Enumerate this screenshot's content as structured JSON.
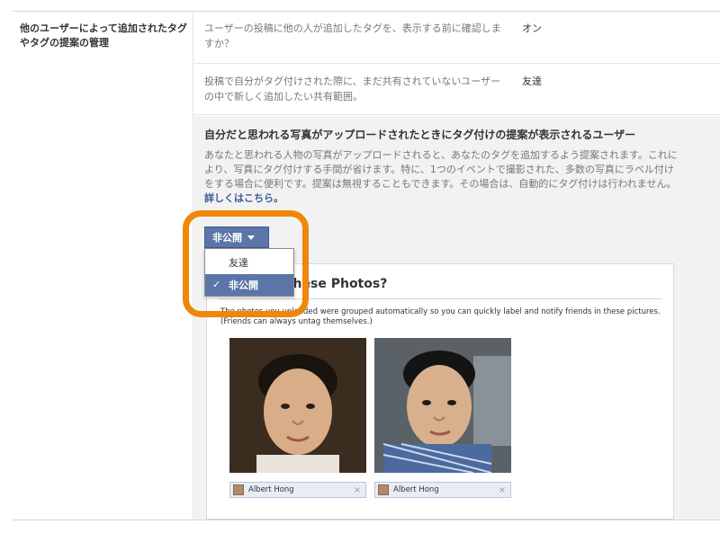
{
  "setting": {
    "label": "他のユーザーによって追加されたタグやタグの提案の管理"
  },
  "rows": [
    {
      "description": "ユーザーの投稿に他の人が追加したタグを、表示する前に確認しますか？",
      "value": "オン"
    },
    {
      "description": "投稿で自分がタグ付けされた際に、まだ共有されていないユーザーの中で新しく追加したい共有範囲。",
      "value": "友達"
    }
  ],
  "panel": {
    "title": "自分だと思われる写真がアップロードされたときにタグ付けの提案が表示されるユーザー",
    "description": "あなたと思われる人物の写真がアップロードされると、あなたのタグを追加するよう提案されます。これにより、写真にタグ付けする手間が省けます。特に、1つのイベントで撮影された、多数の写真にラベル付けをする場合に便利です。提案は無視することもできます。その場合は、自動的にタグ付けは行われません。",
    "link": "詳しくはこちら。"
  },
  "privacy_button": {
    "label": "非公開"
  },
  "menu": {
    "items": [
      {
        "label": "友達",
        "selected": false
      },
      {
        "label": "非公開",
        "selected": true
      }
    ],
    "check": "✓"
  },
  "photo_card": {
    "title": "These Photos?",
    "description": "The photos you uploaded were grouped automatically so you can quickly label and notify friends in these pictures. (Friends can always untag themselves.)",
    "tags": [
      {
        "name": "Albert Hong"
      },
      {
        "name": "Albert Hong"
      }
    ],
    "close_glyph": "×"
  },
  "colors": {
    "highlight": "#f0860a",
    "button": "#5c75a8",
    "link": "#3b5998"
  }
}
